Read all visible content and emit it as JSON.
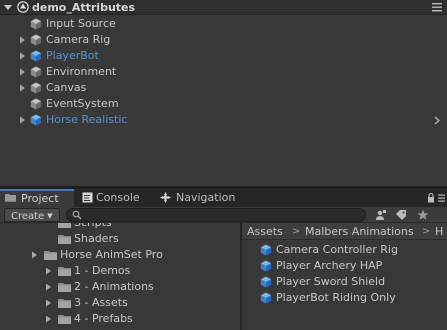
{
  "hierarchy": {
    "scene_name": "demo_Attributes",
    "items": [
      {
        "label": "Input Source",
        "icon": "gameobject-icon",
        "expandable": false,
        "prefab": false
      },
      {
        "label": "Camera Rig",
        "icon": "gameobject-icon",
        "expandable": true,
        "prefab": false
      },
      {
        "label": "PlayerBot",
        "icon": "prefab-icon",
        "expandable": true,
        "prefab": true
      },
      {
        "label": "Environment",
        "icon": "gameobject-icon",
        "expandable": true,
        "prefab": false
      },
      {
        "label": "Canvas",
        "icon": "gameobject-icon",
        "expandable": true,
        "prefab": false
      },
      {
        "label": "EventSystem",
        "icon": "gameobject-icon",
        "expandable": false,
        "prefab": false
      },
      {
        "label": "Horse Realistic",
        "icon": "prefab-icon",
        "expandable": true,
        "prefab": true
      }
    ]
  },
  "tabs": [
    {
      "label": "Project",
      "icon": "folder-icon",
      "active": true
    },
    {
      "label": "Console",
      "icon": "console-icon",
      "active": false
    },
    {
      "label": "Navigation",
      "icon": "navigation-icon",
      "active": false
    }
  ],
  "toolbar": {
    "create_label": "Create",
    "search_placeholder": ""
  },
  "tree": {
    "items": [
      {
        "label": "Scripts",
        "expandable": false
      },
      {
        "label": "Shaders",
        "expandable": false
      },
      {
        "label": "Horse AnimSet Pro",
        "expandable": true
      },
      {
        "label": "1 - Demos",
        "expandable": true
      },
      {
        "label": "2 - Animations",
        "expandable": true
      },
      {
        "label": "3 - Assets",
        "expandable": true
      },
      {
        "label": "4 - Prefabs",
        "expandable": true
      }
    ]
  },
  "assets": {
    "breadcrumb": [
      "Assets",
      "Malbers Animations",
      "H"
    ],
    "separator": ">",
    "items": [
      {
        "label": "Camera Controller Rig",
        "icon": "prefab-icon"
      },
      {
        "label": "Player Archery HAP",
        "icon": "prefab-icon"
      },
      {
        "label": "Player Sword Shield",
        "icon": "prefab-icon"
      },
      {
        "label": "PlayerBot Riding Only",
        "icon": "prefab-icon"
      }
    ]
  },
  "colors": {
    "background": "#383838",
    "prefab_text": "#5d90d6",
    "prefab_icon": "#4a90d9",
    "gameobject_icon": "#9a9a9a",
    "folder": "#8e8e8e",
    "active_tab_accent": "#4a78b8"
  }
}
